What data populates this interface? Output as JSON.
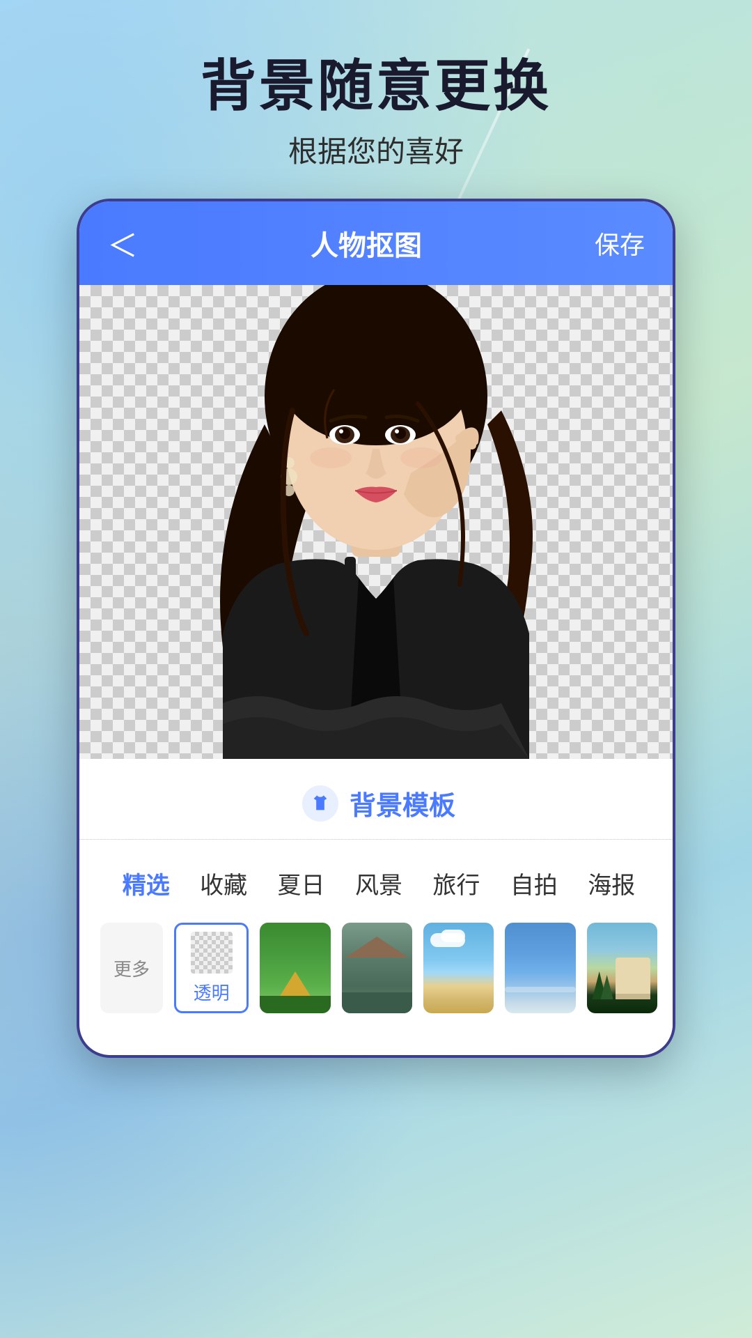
{
  "header": {
    "main_title": "背景随意更换",
    "sub_title": "根据您的喜好"
  },
  "app": {
    "back_label": "＜",
    "title": "人物抠图",
    "save_label": "保存"
  },
  "template_section": {
    "icon": "👕",
    "title": "背景模板"
  },
  "category_tabs": [
    {
      "id": "featured",
      "label": "精选",
      "active": true
    },
    {
      "id": "favorites",
      "label": "收藏",
      "active": false
    },
    {
      "id": "summer",
      "label": "夏日",
      "active": false
    },
    {
      "id": "scenery",
      "label": "风景",
      "active": false
    },
    {
      "id": "travel",
      "label": "旅行",
      "active": false
    },
    {
      "id": "selfie",
      "label": "自拍",
      "active": false
    },
    {
      "id": "poster",
      "label": "海报",
      "active": false
    }
  ],
  "thumbnails": [
    {
      "id": "more",
      "label": "更多",
      "type": "more"
    },
    {
      "id": "transparent",
      "label": "透明",
      "type": "transparent",
      "active": true
    },
    {
      "id": "nature1",
      "label": "",
      "type": "nature1",
      "active": false
    },
    {
      "id": "tent",
      "label": "",
      "type": "tent",
      "active": false
    },
    {
      "id": "sky",
      "label": "",
      "type": "sky",
      "active": false
    },
    {
      "id": "ocean",
      "label": "",
      "type": "ocean",
      "active": false
    },
    {
      "id": "resort",
      "label": "",
      "type": "resort",
      "active": false
    }
  ],
  "colors": {
    "accent": "#4a7aff",
    "active_tab": "#4a7aff",
    "bg_gradient_start": "#b8e0f0",
    "bg_gradient_end": "#d0ecd8"
  }
}
